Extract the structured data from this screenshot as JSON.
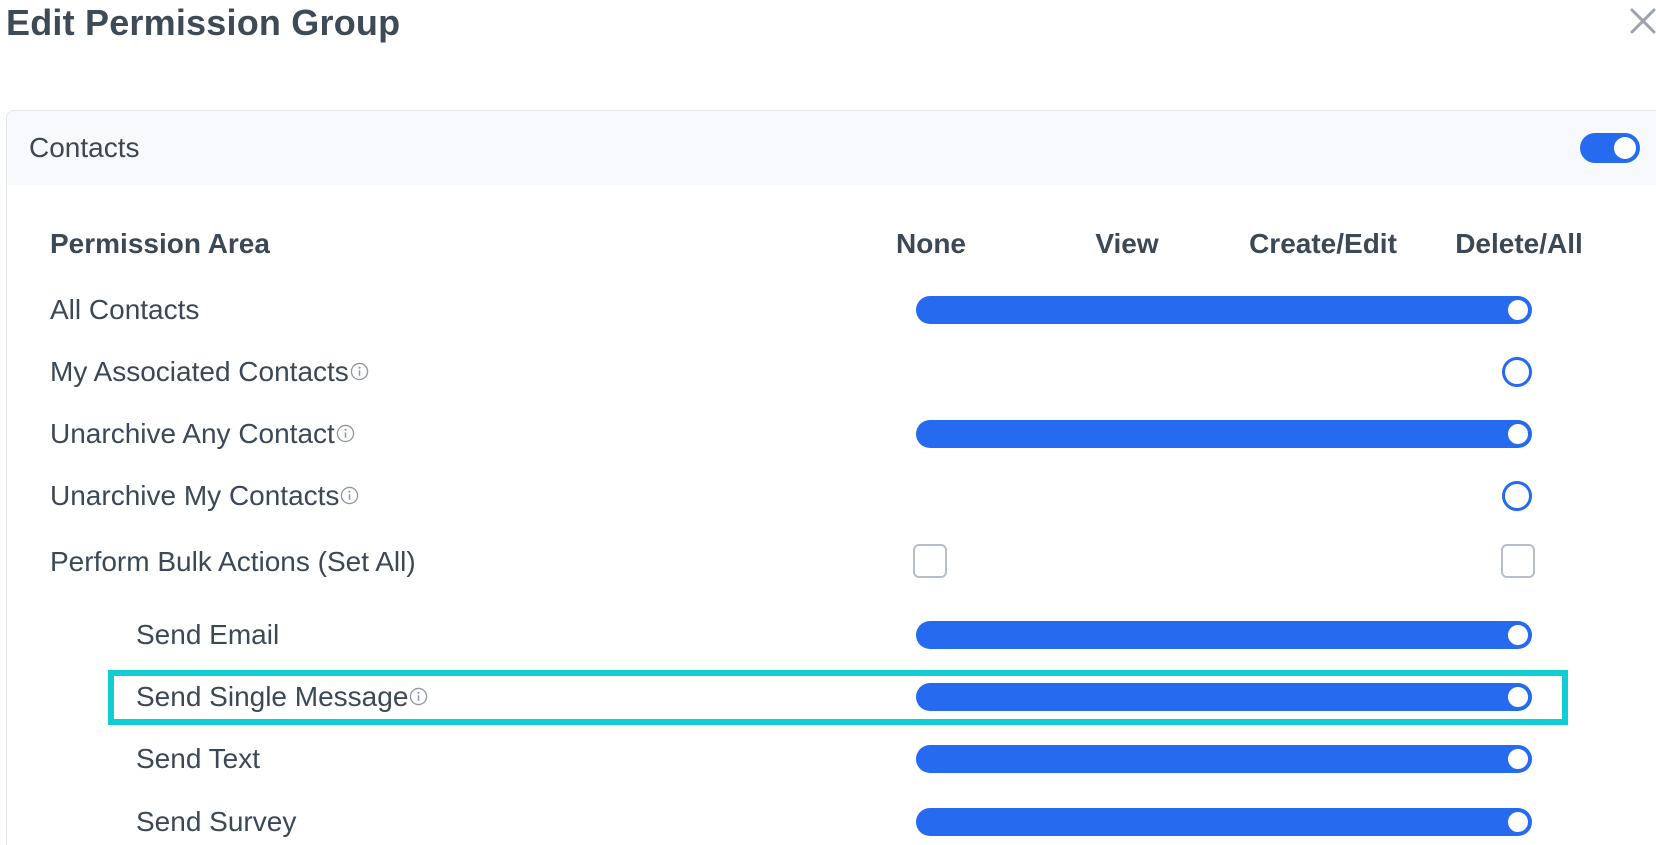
{
  "window": {
    "title": "Edit Permission Group",
    "close_icon": "close-icon"
  },
  "section": {
    "title": "Contacts",
    "enabled": true
  },
  "table": {
    "area_header": "Permission Area",
    "levels": [
      "None",
      "View",
      "Create/Edit",
      "Delete/All"
    ],
    "rows": [
      {
        "label": "All Contacts",
        "info": false,
        "control": "slider",
        "value": "Delete/All"
      },
      {
        "label": "My Associated Contacts",
        "info": true,
        "control": "slider",
        "value": "Delete/All"
      },
      {
        "label": "Unarchive Any Contact",
        "info": true,
        "control": "slider",
        "value": "Delete/All"
      },
      {
        "label": "Unarchive My Contacts",
        "info": true,
        "control": "slider",
        "value": "Delete/All"
      },
      {
        "label": "Perform Bulk Actions (Set All)",
        "info": false,
        "control": "checkboxes",
        "checked_none": false,
        "checked_delete_all": false
      },
      {
        "label": "Send Email",
        "info": false,
        "control": "slider",
        "value": "Delete/All",
        "indented": true
      },
      {
        "label": "Send Single Message",
        "info": true,
        "control": "slider",
        "value": "Delete/All",
        "indented": true,
        "highlighted": true
      },
      {
        "label": "Send Text",
        "info": false,
        "control": "slider",
        "value": "Delete/All",
        "indented": true
      },
      {
        "label": "Send Survey",
        "info": false,
        "control": "slider",
        "value": "Delete/All",
        "indented": true
      }
    ]
  },
  "colors": {
    "accent": "#256aef",
    "highlight": "#12cdd4",
    "text": "#3c4856"
  }
}
